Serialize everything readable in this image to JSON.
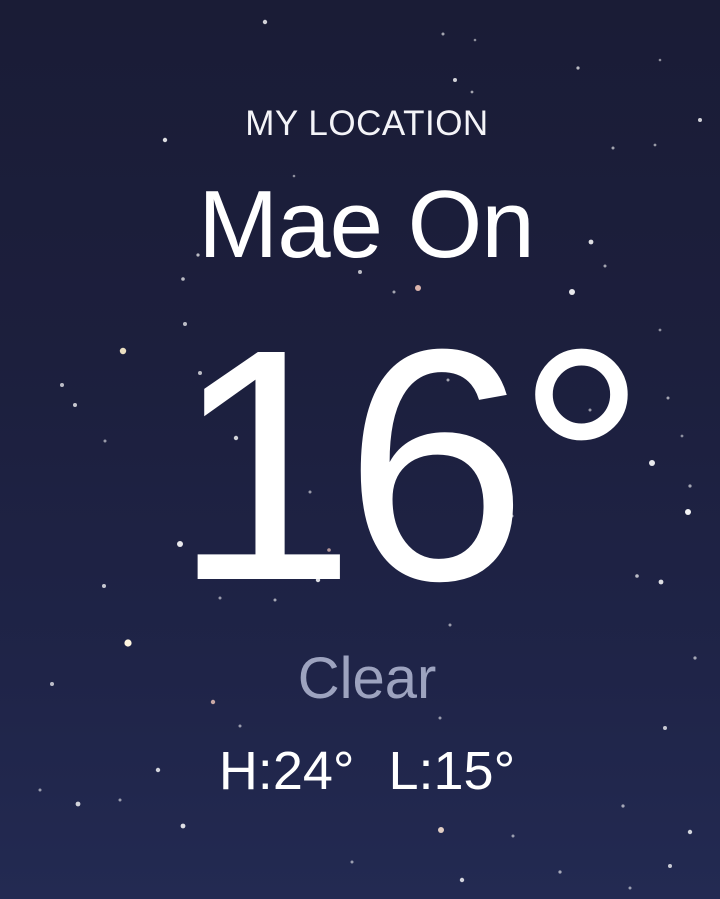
{
  "weather": {
    "location_label": "MY LOCATION",
    "city": "Mae On",
    "temperature": "16°",
    "condition": "Clear",
    "high": "H:24°",
    "low": "L:15°"
  },
  "colors": {
    "background_top": "#1a1c36",
    "background_bottom": "#232a52",
    "condition_text": "#9da3bf"
  }
}
